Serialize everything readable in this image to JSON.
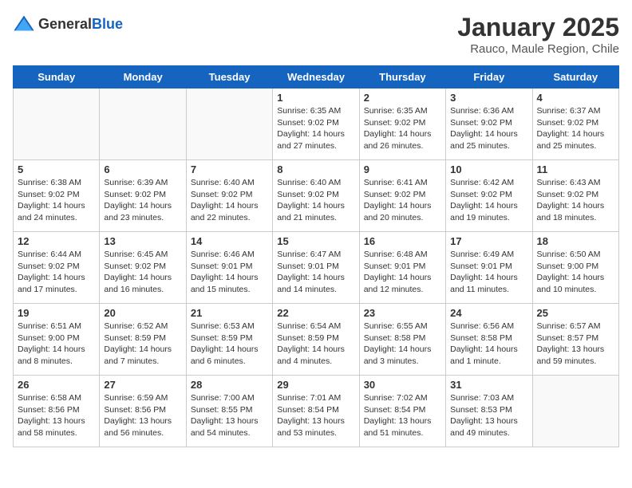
{
  "logo": {
    "general": "General",
    "blue": "Blue"
  },
  "title": "January 2025",
  "subtitle": "Rauco, Maule Region, Chile",
  "days_of_week": [
    "Sunday",
    "Monday",
    "Tuesday",
    "Wednesday",
    "Thursday",
    "Friday",
    "Saturday"
  ],
  "weeks": [
    [
      {
        "day": "",
        "info": ""
      },
      {
        "day": "",
        "info": ""
      },
      {
        "day": "",
        "info": ""
      },
      {
        "day": "1",
        "info": "Sunrise: 6:35 AM\nSunset: 9:02 PM\nDaylight: 14 hours and 27 minutes."
      },
      {
        "day": "2",
        "info": "Sunrise: 6:35 AM\nSunset: 9:02 PM\nDaylight: 14 hours and 26 minutes."
      },
      {
        "day": "3",
        "info": "Sunrise: 6:36 AM\nSunset: 9:02 PM\nDaylight: 14 hours and 25 minutes."
      },
      {
        "day": "4",
        "info": "Sunrise: 6:37 AM\nSunset: 9:02 PM\nDaylight: 14 hours and 25 minutes."
      }
    ],
    [
      {
        "day": "5",
        "info": "Sunrise: 6:38 AM\nSunset: 9:02 PM\nDaylight: 14 hours and 24 minutes."
      },
      {
        "day": "6",
        "info": "Sunrise: 6:39 AM\nSunset: 9:02 PM\nDaylight: 14 hours and 23 minutes."
      },
      {
        "day": "7",
        "info": "Sunrise: 6:40 AM\nSunset: 9:02 PM\nDaylight: 14 hours and 22 minutes."
      },
      {
        "day": "8",
        "info": "Sunrise: 6:40 AM\nSunset: 9:02 PM\nDaylight: 14 hours and 21 minutes."
      },
      {
        "day": "9",
        "info": "Sunrise: 6:41 AM\nSunset: 9:02 PM\nDaylight: 14 hours and 20 minutes."
      },
      {
        "day": "10",
        "info": "Sunrise: 6:42 AM\nSunset: 9:02 PM\nDaylight: 14 hours and 19 minutes."
      },
      {
        "day": "11",
        "info": "Sunrise: 6:43 AM\nSunset: 9:02 PM\nDaylight: 14 hours and 18 minutes."
      }
    ],
    [
      {
        "day": "12",
        "info": "Sunrise: 6:44 AM\nSunset: 9:02 PM\nDaylight: 14 hours and 17 minutes."
      },
      {
        "day": "13",
        "info": "Sunrise: 6:45 AM\nSunset: 9:02 PM\nDaylight: 14 hours and 16 minutes."
      },
      {
        "day": "14",
        "info": "Sunrise: 6:46 AM\nSunset: 9:01 PM\nDaylight: 14 hours and 15 minutes."
      },
      {
        "day": "15",
        "info": "Sunrise: 6:47 AM\nSunset: 9:01 PM\nDaylight: 14 hours and 14 minutes."
      },
      {
        "day": "16",
        "info": "Sunrise: 6:48 AM\nSunset: 9:01 PM\nDaylight: 14 hours and 12 minutes."
      },
      {
        "day": "17",
        "info": "Sunrise: 6:49 AM\nSunset: 9:01 PM\nDaylight: 14 hours and 11 minutes."
      },
      {
        "day": "18",
        "info": "Sunrise: 6:50 AM\nSunset: 9:00 PM\nDaylight: 14 hours and 10 minutes."
      }
    ],
    [
      {
        "day": "19",
        "info": "Sunrise: 6:51 AM\nSunset: 9:00 PM\nDaylight: 14 hours and 8 minutes."
      },
      {
        "day": "20",
        "info": "Sunrise: 6:52 AM\nSunset: 8:59 PM\nDaylight: 14 hours and 7 minutes."
      },
      {
        "day": "21",
        "info": "Sunrise: 6:53 AM\nSunset: 8:59 PM\nDaylight: 14 hours and 6 minutes."
      },
      {
        "day": "22",
        "info": "Sunrise: 6:54 AM\nSunset: 8:59 PM\nDaylight: 14 hours and 4 minutes."
      },
      {
        "day": "23",
        "info": "Sunrise: 6:55 AM\nSunset: 8:58 PM\nDaylight: 14 hours and 3 minutes."
      },
      {
        "day": "24",
        "info": "Sunrise: 6:56 AM\nSunset: 8:58 PM\nDaylight: 14 hours and 1 minute."
      },
      {
        "day": "25",
        "info": "Sunrise: 6:57 AM\nSunset: 8:57 PM\nDaylight: 13 hours and 59 minutes."
      }
    ],
    [
      {
        "day": "26",
        "info": "Sunrise: 6:58 AM\nSunset: 8:56 PM\nDaylight: 13 hours and 58 minutes."
      },
      {
        "day": "27",
        "info": "Sunrise: 6:59 AM\nSunset: 8:56 PM\nDaylight: 13 hours and 56 minutes."
      },
      {
        "day": "28",
        "info": "Sunrise: 7:00 AM\nSunset: 8:55 PM\nDaylight: 13 hours and 54 minutes."
      },
      {
        "day": "29",
        "info": "Sunrise: 7:01 AM\nSunset: 8:54 PM\nDaylight: 13 hours and 53 minutes."
      },
      {
        "day": "30",
        "info": "Sunrise: 7:02 AM\nSunset: 8:54 PM\nDaylight: 13 hours and 51 minutes."
      },
      {
        "day": "31",
        "info": "Sunrise: 7:03 AM\nSunset: 8:53 PM\nDaylight: 13 hours and 49 minutes."
      },
      {
        "day": "",
        "info": ""
      }
    ]
  ]
}
